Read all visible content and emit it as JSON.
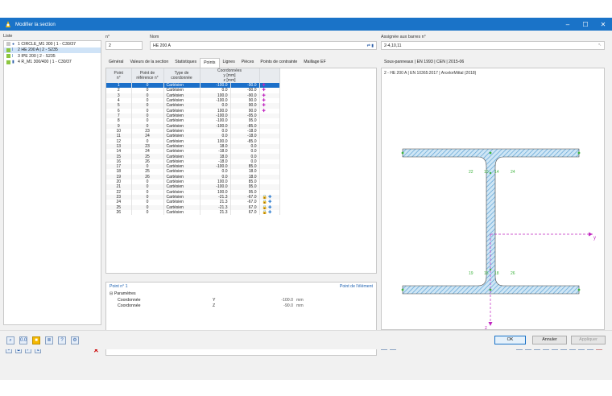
{
  "window": {
    "title": "Modifier la section",
    "controls": [
      "–",
      "☐",
      "✕"
    ]
  },
  "list": {
    "label": "Liste",
    "items": [
      {
        "text": "1  CIRCLE_M1 300 | 1 - C30/37",
        "swatch": "#c8c8c8",
        "icon": "circle-icon"
      },
      {
        "text": "2  HE 200 A | 2 - S235",
        "swatch": "#8cc63f",
        "icon": "i-beam-icon",
        "selected": true
      },
      {
        "text": "3  IPE 200 | 2 - S235",
        "swatch": "#8cc63f",
        "icon": "i-beam-icon"
      },
      {
        "text": "4  R_M1 300/400 | 1 - C30/37",
        "swatch": "#8cc63f",
        "icon": "rectangle-icon"
      }
    ]
  },
  "fields": {
    "no_label": "n°",
    "no_value": "2",
    "name_label": "Nom",
    "name_value": "HE 200 A",
    "assigned_label": "Assignée aux barres n°",
    "assigned_value": "2-4,10,11"
  },
  "tabs": [
    "Général",
    "Valeurs de la section",
    "Statistiques",
    "Points",
    "Lignes",
    "Pièces",
    "Points de contrainte",
    "Maillage EF"
  ],
  "active_tab": "Points",
  "right_tab": "Sous-panneaux | EN 1993 | CEN | 2015-06",
  "table": {
    "headers": {
      "point": "Point",
      "point_sub": "n°",
      "ref": "Point de",
      "ref_sub": "référence n°",
      "type": "Type de",
      "type_sub": "coordonnée",
      "coords": "Coordonnées",
      "y": "y [mm]",
      "z": "z [mm]"
    },
    "rows": [
      {
        "n": "1",
        "ref": "0",
        "type": "Cartésien",
        "y": "-100.0",
        "z": "-90.0",
        "mark": "plus"
      },
      {
        "n": "2",
        "ref": "0",
        "type": "Cartésien",
        "y": "0.0",
        "z": "-90.0",
        "mark": "plus"
      },
      {
        "n": "3",
        "ref": "0",
        "type": "Cartésien",
        "y": "100.0",
        "z": "-90.0",
        "mark": "plus"
      },
      {
        "n": "4",
        "ref": "0",
        "type": "Cartésien",
        "y": "-100.0",
        "z": "90.0",
        "mark": "plus"
      },
      {
        "n": "5",
        "ref": "0",
        "type": "Cartésien",
        "y": "0.0",
        "z": "90.0",
        "mark": "plus"
      },
      {
        "n": "6",
        "ref": "0",
        "type": "Cartésien",
        "y": "100.0",
        "z": "90.0",
        "mark": "plus"
      },
      {
        "n": "7",
        "ref": "0",
        "type": "Cartésien",
        "y": "-100.0",
        "z": "-95.0"
      },
      {
        "n": "8",
        "ref": "0",
        "type": "Cartésien",
        "y": "-100.0",
        "z": "95.0"
      },
      {
        "n": "9",
        "ref": "0",
        "type": "Cartésien",
        "y": "-100.0",
        "z": "-85.0"
      },
      {
        "n": "10",
        "ref": "23",
        "type": "Cartésien",
        "y": "0.0",
        "z": "-18.0"
      },
      {
        "n": "11",
        "ref": "24",
        "type": "Cartésien",
        "y": "0.0",
        "z": "-18.0"
      },
      {
        "n": "12",
        "ref": "0",
        "type": "Cartésien",
        "y": "100.0",
        "z": "-85.0"
      },
      {
        "n": "13",
        "ref": "23",
        "type": "Cartésien",
        "y": "18.0",
        "z": "0.0"
      },
      {
        "n": "14",
        "ref": "24",
        "type": "Cartésien",
        "y": "-18.0",
        "z": "0.0"
      },
      {
        "n": "15",
        "ref": "25",
        "type": "Cartésien",
        "y": "18.0",
        "z": "0.0"
      },
      {
        "n": "16",
        "ref": "26",
        "type": "Cartésien",
        "y": "-18.0",
        "z": "0.0"
      },
      {
        "n": "17",
        "ref": "0",
        "type": "Cartésien",
        "y": "-100.0",
        "z": "85.0"
      },
      {
        "n": "18",
        "ref": "25",
        "type": "Cartésien",
        "y": "0.0",
        "z": "18.0"
      },
      {
        "n": "19",
        "ref": "26",
        "type": "Cartésien",
        "y": "0.0",
        "z": "18.0"
      },
      {
        "n": "20",
        "ref": "0",
        "type": "Cartésien",
        "y": "100.0",
        "z": "85.0"
      },
      {
        "n": "21",
        "ref": "0",
        "type": "Cartésien",
        "y": "-100.0",
        "z": "95.0"
      },
      {
        "n": "22",
        "ref": "0",
        "type": "Cartésien",
        "y": "100.0",
        "z": "95.0"
      },
      {
        "n": "23",
        "ref": "0",
        "type": "Cartésien",
        "y": "-21.3",
        "z": "-67.0",
        "mark": "lock-blue"
      },
      {
        "n": "24",
        "ref": "0",
        "type": "Cartésien",
        "y": "21.3",
        "z": "-67.0",
        "mark": "lock-blue"
      },
      {
        "n": "25",
        "ref": "0",
        "type": "Cartésien",
        "y": "-21.3",
        "z": "67.0",
        "mark": "lock-blue"
      },
      {
        "n": "26",
        "ref": "0",
        "type": "Cartésien",
        "y": "21.3",
        "z": "67.0",
        "mark": "lock-blue"
      }
    ]
  },
  "props": {
    "title": "Point n° 1",
    "right": "Point de l'élément",
    "group": "Paramètres",
    "rows": [
      {
        "name": "Coordonnée",
        "sym": "Y",
        "val": "-100.0",
        "unit": "mm"
      },
      {
        "name": "Coordonnée",
        "sym": "Z",
        "val": "-90.0",
        "unit": "mm"
      }
    ]
  },
  "graphic": {
    "caption": "2 - HE 200 A | EN 10365:2017 | ArcelorMittal (2018)",
    "y_axis": "y",
    "z_axis": "z",
    "labels": [
      "22",
      "10",
      "14",
      "24",
      "19",
      "15",
      "18",
      "26"
    ],
    "hatch_color": "#5da2d5",
    "point_color": "#3db33d",
    "axis_color": "#c026c0"
  },
  "graphic_select": "--",
  "footer": {
    "ok": "OK",
    "cancel": "Annuler",
    "apply": "Appliquer"
  }
}
